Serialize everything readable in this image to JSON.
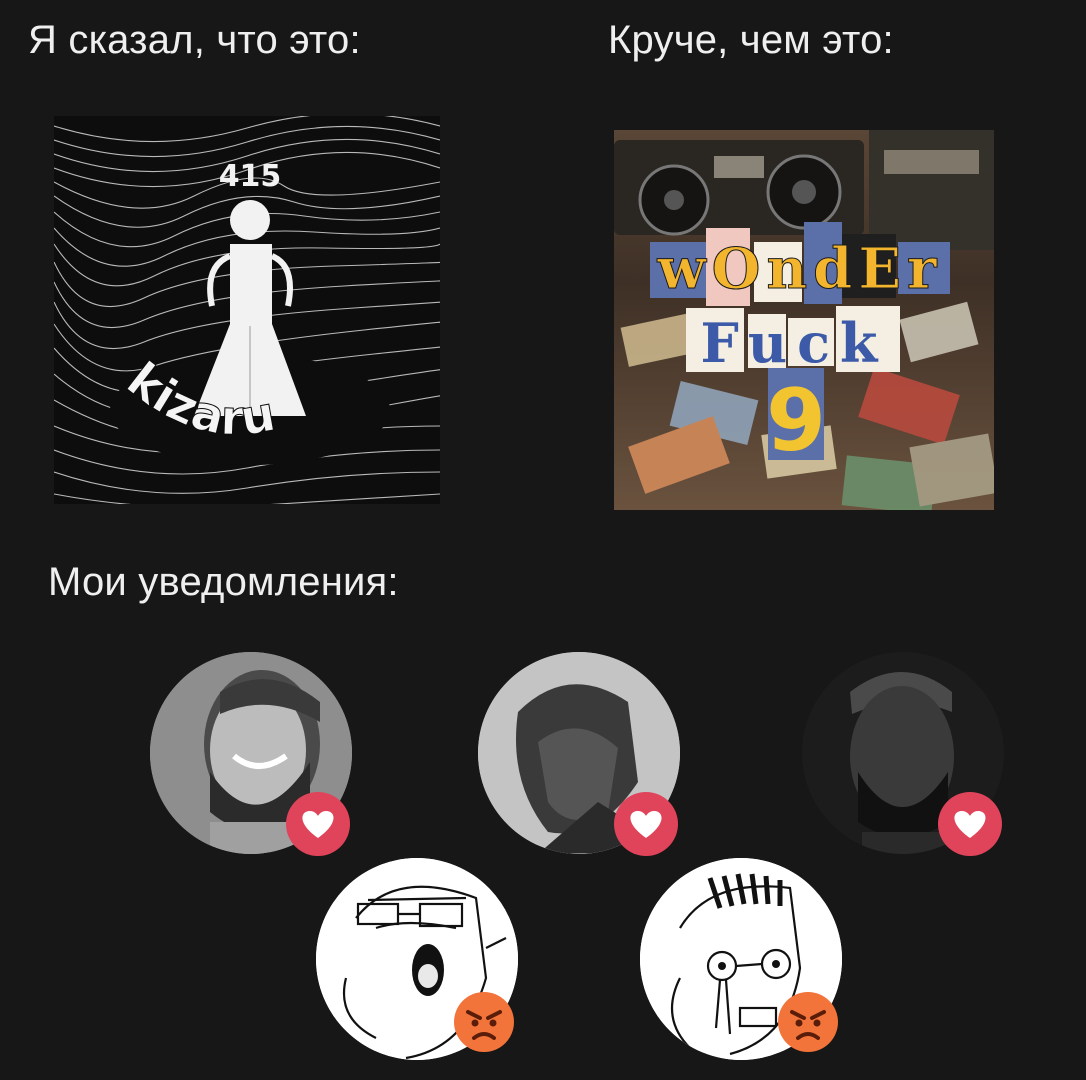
{
  "captions": {
    "left": "Я сказал, что это:",
    "right": "Круче, чем это:",
    "notifications": "Мои уведомления:"
  },
  "cover_left": {
    "top_number": "415",
    "brand_text": "kizaru"
  },
  "cover_right": {
    "title_line1": "wOndEr",
    "title_line2": "Fuck",
    "number": "9"
  },
  "notifications": [
    {
      "avatar": "gigachad-smiling",
      "reaction": "heart-icon"
    },
    {
      "avatar": "gigachad-profile",
      "reaction": "heart-icon"
    },
    {
      "avatar": "gigachad-dark",
      "reaction": "heart-icon"
    },
    {
      "avatar": "wojak-shouting",
      "reaction": "angry-face-icon"
    },
    {
      "avatar": "wojak-crying",
      "reaction": "angry-face-icon"
    }
  ],
  "colors": {
    "background": "#161716",
    "heart_badge": "#e0445a",
    "angry_face": "#f2743a"
  }
}
